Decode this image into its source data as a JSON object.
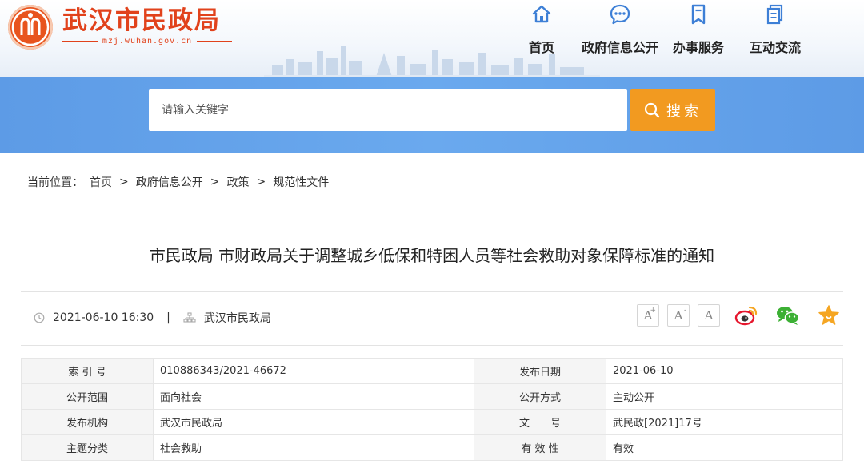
{
  "site": {
    "title": "武汉市民政局",
    "domain": "mzj.wuhan.gov.cn"
  },
  "nav": [
    {
      "label": "首页",
      "icon": "home-icon"
    },
    {
      "label": "政府信息公开",
      "icon": "chat-bubble-icon"
    },
    {
      "label": "办事服务",
      "icon": "bookmark-icon"
    },
    {
      "label": "互动交流",
      "icon": "document-icon"
    }
  ],
  "search": {
    "placeholder": "请输入关键字",
    "button_label": "搜索"
  },
  "breadcrumb": {
    "prefix": "当前位置：",
    "items": [
      "首页",
      "政府信息公开",
      "政策",
      "规范性文件"
    ],
    "separator": ">"
  },
  "article": {
    "title": "市民政局 市财政局关于调整城乡低保和特困人员等社会救助对象保障标准的通知",
    "datetime": "2021-06-10 16:30",
    "separator": "|",
    "source": "武汉市民政局"
  },
  "font_controls": [
    {
      "glyph": "A",
      "sup": "+"
    },
    {
      "glyph": "A",
      "sup": "-"
    },
    {
      "glyph": "A",
      "sup": ""
    }
  ],
  "share_icons": [
    "weibo-icon",
    "wechat-icon",
    "favorite-star-icon"
  ],
  "colors": {
    "brand_red": "#e1421c",
    "band_blue": "#6aa9ee",
    "search_orange": "#f29a20"
  },
  "info_table": {
    "rows": [
      {
        "k1": "索 引 号",
        "v1": "010886343/2021-46672",
        "k2": "发布日期",
        "v2": "2021-06-10"
      },
      {
        "k1": "公开范围",
        "v1": "面向社会",
        "k2": "公开方式",
        "v2": "主动公开"
      },
      {
        "k1": "发布机构",
        "v1": "武汉市民政局",
        "k2": "文　　号",
        "v2": "武民政[2021]17号"
      },
      {
        "k1": "主题分类",
        "v1": "社会救助",
        "k2": "有 效 性",
        "v2": "有效"
      }
    ]
  }
}
